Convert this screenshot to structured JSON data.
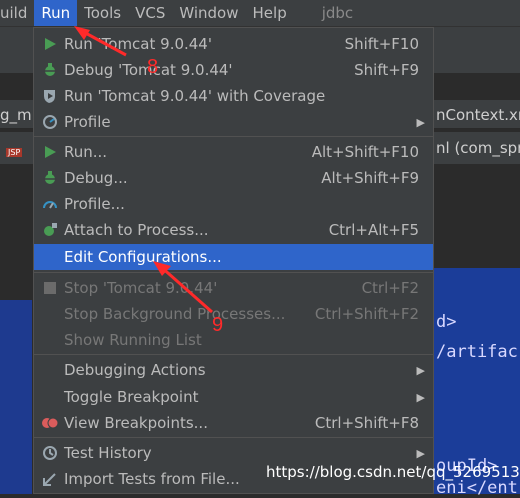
{
  "menubar": {
    "items": [
      "uild",
      "Run",
      "Tools",
      "VCS",
      "Window",
      "Help"
    ],
    "project": "jdbc"
  },
  "background": {
    "left_frag1": "g_m",
    "tab_right1": "nContext.xm",
    "tab_right2": "nl (com_spri",
    "jsp_badge": "JSP",
    "code_lines": [
      "d>",
      "/artifac",
      "oupId>",
      "eni</ent"
    ]
  },
  "menu": {
    "items": [
      {
        "label": "Run 'Tomcat 9.0.44'",
        "shortcut": "Shift+F10",
        "icon": "run-icon"
      },
      {
        "label": "Debug 'Tomcat 9.0.44'",
        "shortcut": "Shift+F9",
        "icon": "debug-icon"
      },
      {
        "label": "Run 'Tomcat 9.0.44' with Coverage",
        "shortcut": "",
        "icon": "coverage-icon"
      },
      {
        "label": "Profile",
        "shortcut": "",
        "icon": "profile-icon",
        "submenu": true
      },
      {
        "label": "Run...",
        "shortcut": "Alt+Shift+F10",
        "icon": "run-icon"
      },
      {
        "label": "Debug...",
        "shortcut": "Alt+Shift+F9",
        "icon": "debug-icon"
      },
      {
        "label": "Profile...",
        "shortcut": "",
        "icon": "profile-icon"
      },
      {
        "label": "Attach to Process...",
        "shortcut": "Ctrl+Alt+F5",
        "icon": "attach-icon"
      },
      {
        "label": "Edit Configurations...",
        "shortcut": "",
        "icon": "",
        "selected": true
      },
      {
        "label": "Stop 'Tomcat 9.0.44'",
        "shortcut": "Ctrl+F2",
        "icon": "stop-icon",
        "disabled": true
      },
      {
        "label": "Stop Background Processes...",
        "shortcut": "Ctrl+Shift+F2",
        "icon": "",
        "disabled": true
      },
      {
        "label": "Show Running List",
        "shortcut": "",
        "icon": "",
        "disabled": true
      },
      {
        "label": "Debugging Actions",
        "shortcut": "",
        "icon": "",
        "submenu": true
      },
      {
        "label": "Toggle Breakpoint",
        "shortcut": "",
        "icon": "",
        "submenu": true
      },
      {
        "label": "View Breakpoints...",
        "shortcut": "Ctrl+Shift+F8",
        "icon": "breakpoints-icon"
      },
      {
        "label": "Test History",
        "shortcut": "",
        "icon": "history-icon",
        "submenu": true
      },
      {
        "label": "Import Tests from File...",
        "shortcut": "",
        "icon": "import-icon"
      }
    ]
  },
  "annotations": {
    "a8": "8",
    "a9": "9"
  },
  "watermark": "https://blog.csdn.net/qq_52695134",
  "colors": {
    "accent": "#2f65ca",
    "menu_bg": "#3c3f41",
    "annotation": "#ff2a2a"
  }
}
